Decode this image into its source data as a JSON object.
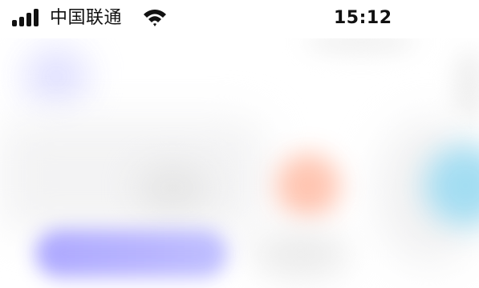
{
  "status_bar": {
    "carrier": "中国联通",
    "time": "15:12",
    "signal_icon": "cellular-signal-icon",
    "wifi_icon": "wifi-icon",
    "signal_bars": 4
  },
  "colors": {
    "text": "#111111",
    "avatar_blur": "#dcdcff",
    "salmon_blur": "#ffbfa9",
    "cyan_blur": "#9fdcf2",
    "button_blur": "#aeaaff"
  }
}
